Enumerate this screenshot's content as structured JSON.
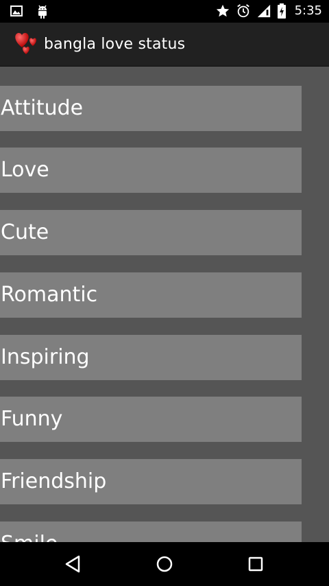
{
  "status_bar": {
    "time": "5:35",
    "left_icons": [
      "image-icon",
      "android-icon"
    ],
    "right_icons": [
      "star-icon",
      "alarm-icon",
      "signal-icon",
      "battery-icon"
    ]
  },
  "action_bar": {
    "title": "bangla love status",
    "app_icon": "hearts-icon"
  },
  "categories": [
    {
      "label": "Attitude"
    },
    {
      "label": "Love"
    },
    {
      "label": "Cute"
    },
    {
      "label": "Romantic"
    },
    {
      "label": "Inspiring"
    },
    {
      "label": "Funny"
    },
    {
      "label": "Friendship"
    },
    {
      "label": "Smile"
    }
  ],
  "nav_bar": {
    "buttons": [
      "back-icon",
      "home-icon",
      "recents-icon"
    ]
  },
  "colors": {
    "background": "#555555",
    "item": "#7f7f7f",
    "action_bar": "#212121",
    "status_bar": "#000000"
  }
}
